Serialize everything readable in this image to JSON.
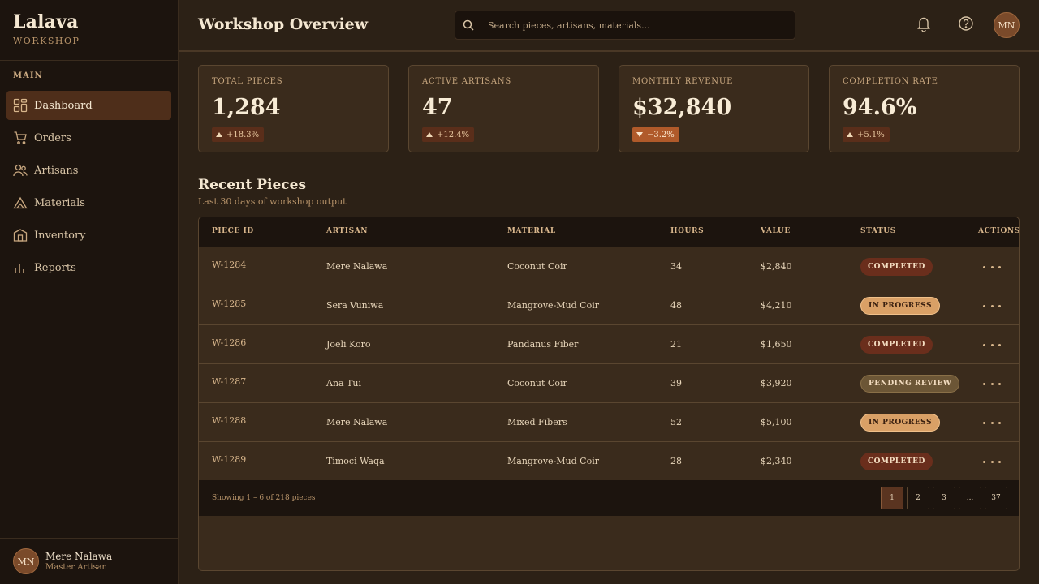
{
  "brand": {
    "name": "Lalava",
    "sub": "WORKSHOP"
  },
  "sidebar": {
    "section": "MAIN",
    "items": [
      {
        "label": "Dashboard",
        "icon": "dashboard-icon",
        "active": true
      },
      {
        "label": "Orders",
        "icon": "cart-icon"
      },
      {
        "label": "Artisans",
        "icon": "users-icon"
      },
      {
        "label": "Materials",
        "icon": "triangle-icon"
      },
      {
        "label": "Inventory",
        "icon": "box-icon"
      },
      {
        "label": "Reports",
        "icon": "bar-chart-icon"
      }
    ],
    "user": {
      "initials": "MN",
      "name": "Mere Nalawa",
      "role": "Master Artisan"
    }
  },
  "header": {
    "title": "Workshop Overview",
    "search_placeholder": "Search pieces, artisans, materials...",
    "avatar_initials": "MN"
  },
  "stats": [
    {
      "label": "TOTAL PIECES",
      "value": "1,284",
      "trend": "+18.3%",
      "direction": "up"
    },
    {
      "label": "ACTIVE ARTISANS",
      "value": "47",
      "trend": "+12.4%",
      "direction": "up"
    },
    {
      "label": "MONTHLY REVENUE",
      "value": "$32,840",
      "trend": "−3.2%",
      "direction": "down"
    },
    {
      "label": "COMPLETION RATE",
      "value": "94.6%",
      "trend": "+5.1%",
      "direction": "up"
    }
  ],
  "recent": {
    "title": "Recent Pieces",
    "subtitle": "Last 30 days of workshop output",
    "columns": [
      "PIECE ID",
      "ARTISAN",
      "MATERIAL",
      "HOURS",
      "VALUE",
      "STATUS",
      "ACTIONS"
    ],
    "rows": [
      {
        "id": "W-1284",
        "artisan": "Mere Nalawa",
        "material": "Coconut Coir",
        "hours": "34",
        "value": "$2,840",
        "status": "COMPLETED",
        "status_type": "completed"
      },
      {
        "id": "W-1285",
        "artisan": "Sera Vuniwa",
        "material": "Mangrove-Mud Coir",
        "hours": "48",
        "value": "$4,210",
        "status": "IN PROGRESS",
        "status_type": "progress"
      },
      {
        "id": "W-1286",
        "artisan": "Joeli Koro",
        "material": "Pandanus Fiber",
        "hours": "21",
        "value": "$1,650",
        "status": "COMPLETED",
        "status_type": "completed"
      },
      {
        "id": "W-1287",
        "artisan": "Ana Tui",
        "material": "Coconut Coir",
        "hours": "39",
        "value": "$3,920",
        "status": "PENDING REVIEW",
        "status_type": "pending"
      },
      {
        "id": "W-1288",
        "artisan": "Mere Nalawa",
        "material": "Mixed Fibers",
        "hours": "52",
        "value": "$5,100",
        "status": "IN PROGRESS",
        "status_type": "progress"
      },
      {
        "id": "W-1289",
        "artisan": "Timoci Waqa",
        "material": "Mangrove-Mud Coir",
        "hours": "28",
        "value": "$2,340",
        "status": "COMPLETED",
        "status_type": "completed"
      }
    ],
    "showing": "Showing 1 – 6 of 218 pieces",
    "pages": [
      "1",
      "2",
      "3",
      "...",
      "37"
    ],
    "current_page": "1"
  }
}
